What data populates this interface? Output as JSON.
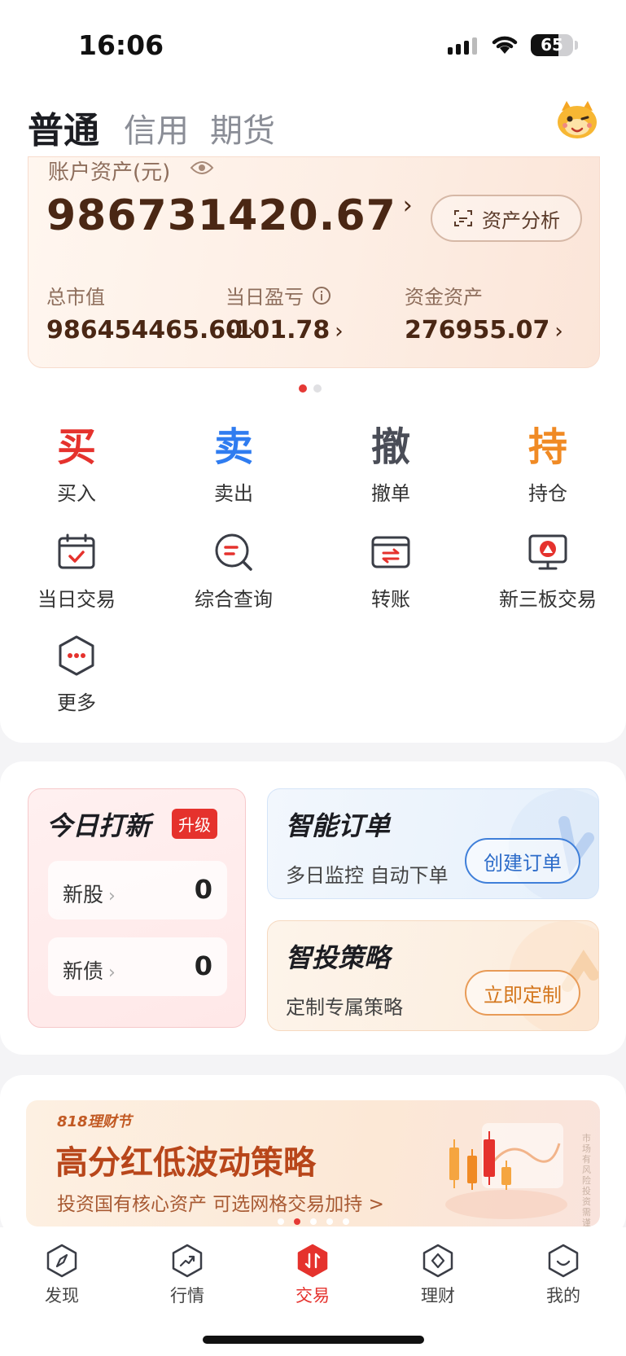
{
  "status_bar": {
    "time": "16:06",
    "battery": "65",
    "battery_level": 0.65
  },
  "header": {
    "tabs": [
      {
        "label": "普通",
        "active": true
      },
      {
        "label": "信用",
        "active": false
      },
      {
        "label": "期货",
        "active": false
      }
    ],
    "avatar_icon": "mascot-icon"
  },
  "asset_card": {
    "label": "账户资产(元)",
    "total": "986731420.67",
    "analysis_button": "资产分析",
    "stats": [
      {
        "label": "总市值",
        "value": "986454465.60"
      },
      {
        "label": "当日盈亏",
        "value": "-101.78",
        "info_icon": "info-icon"
      },
      {
        "label": "资金资产",
        "value": "276955.07"
      }
    ],
    "page_indicator": {
      "count": 2,
      "active": 0
    }
  },
  "quick_actions": [
    {
      "char": "买",
      "label": "买入",
      "color": "#e5322d"
    },
    {
      "char": "卖",
      "label": "卖出",
      "color": "#2f7cf0"
    },
    {
      "char": "撤",
      "label": "撤单",
      "color": "#4a4d57"
    },
    {
      "char": "持",
      "label": "持仓",
      "color": "#f08a24"
    }
  ],
  "tools": [
    {
      "label": "当日交易",
      "icon": "calendar-check-icon"
    },
    {
      "label": "综合查询",
      "icon": "search-query-icon"
    },
    {
      "label": "转账",
      "icon": "transfer-icon"
    },
    {
      "label": "新三板交易",
      "icon": "monitor-icon"
    },
    {
      "label": "更多",
      "icon": "more-hexagon-icon"
    }
  ],
  "ipo_card": {
    "title": "今日打新",
    "badge": "升级",
    "rows": [
      {
        "label": "新股",
        "value": "0"
      },
      {
        "label": "新债",
        "value": "0"
      }
    ]
  },
  "smart_order": {
    "title": "智能订单",
    "subtitle": "多日监控 自动下单",
    "button": "创建订单"
  },
  "strategy": {
    "title": "智投策略",
    "subtitle": "定制专属策略",
    "button": "立即定制"
  },
  "banner": {
    "tag": "818理财节",
    "title": "高分红低波动策略",
    "subtitle": "投资国有核心资产 可选网格交易加持 >",
    "side_text": "市场有风险投资需谨慎",
    "dots": 5,
    "active_dot": 1
  },
  "tabbar": [
    {
      "label": "发现",
      "icon": "compass-icon",
      "active": false
    },
    {
      "label": "行情",
      "icon": "trend-icon",
      "active": false
    },
    {
      "label": "交易",
      "icon": "trade-icon",
      "active": true
    },
    {
      "label": "理财",
      "icon": "wealth-icon",
      "active": false
    },
    {
      "label": "我的",
      "icon": "profile-icon",
      "active": false
    }
  ],
  "colors": {
    "accent": "#e5322d",
    "asset_text": "#4a2714",
    "blue": "#2f7cf0",
    "orange": "#f08a24"
  }
}
